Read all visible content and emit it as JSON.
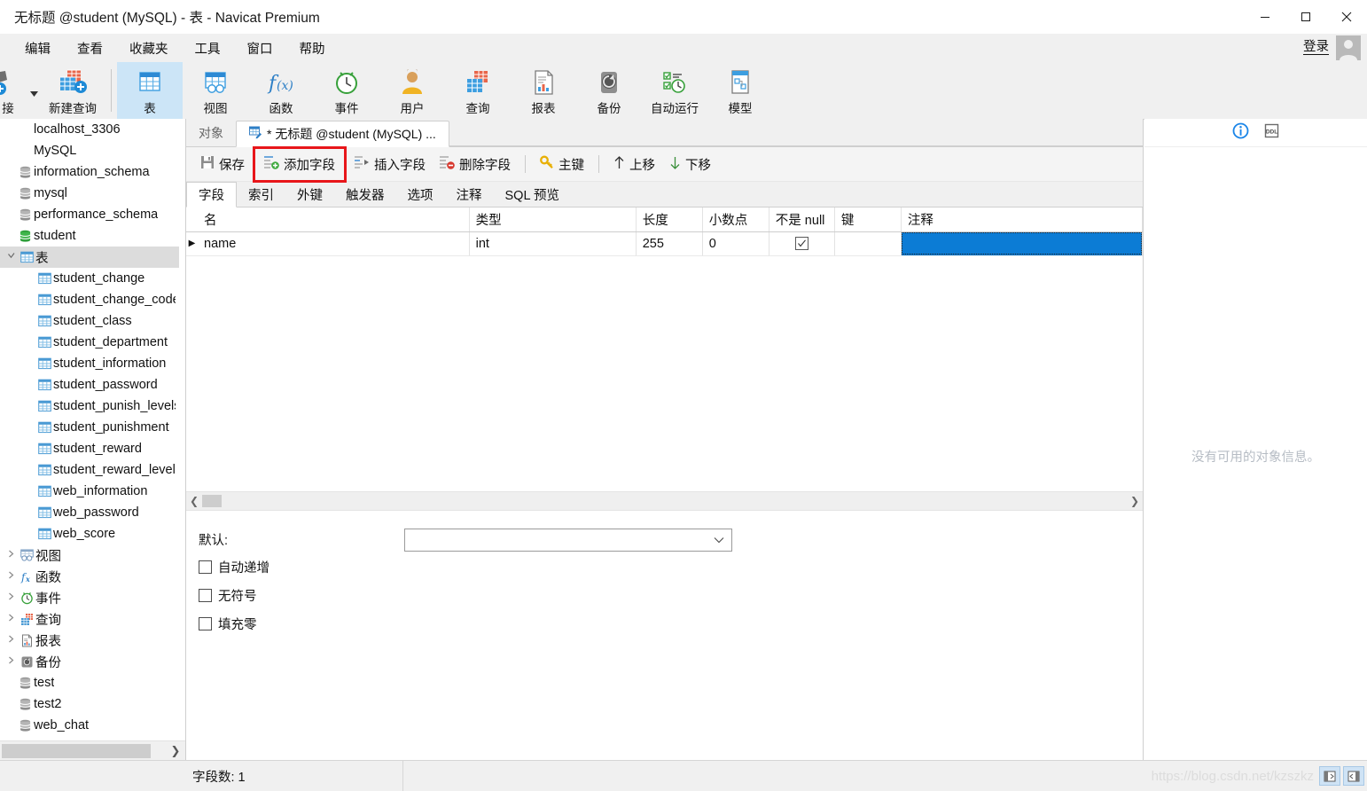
{
  "window": {
    "title": "无标题 @student (MySQL) - 表 - Navicat Premium",
    "minimize_label": "最小化",
    "maximize_label": "最大化",
    "close_label": "关闭"
  },
  "menubar": {
    "items": [
      {
        "label": "编辑",
        "name": "menu-edit"
      },
      {
        "label": "查看",
        "name": "menu-view"
      },
      {
        "label": "收藏夹",
        "name": "menu-favorites"
      },
      {
        "label": "工具",
        "name": "menu-tools"
      },
      {
        "label": "窗口",
        "name": "menu-window"
      },
      {
        "label": "帮助",
        "name": "menu-help"
      }
    ],
    "login_label": "登录"
  },
  "toolbar": {
    "items": [
      {
        "label": "接",
        "icon": "connection-icon",
        "active": false
      },
      {
        "label": "新建查询",
        "icon": "new-query-icon",
        "active": false
      },
      {
        "label": "表",
        "icon": "table-icon",
        "active": true
      },
      {
        "label": "视图",
        "icon": "view-icon",
        "active": false
      },
      {
        "label": "函数",
        "icon": "function-icon",
        "active": false
      },
      {
        "label": "事件",
        "icon": "event-icon",
        "active": false
      },
      {
        "label": "用户",
        "icon": "user-icon",
        "active": false
      },
      {
        "label": "查询",
        "icon": "query-icon",
        "active": false
      },
      {
        "label": "报表",
        "icon": "report-icon",
        "active": false
      },
      {
        "label": "备份",
        "icon": "backup-icon",
        "active": false
      },
      {
        "label": "自动运行",
        "icon": "automation-icon",
        "active": false
      },
      {
        "label": "模型",
        "icon": "model-icon",
        "active": false
      }
    ]
  },
  "sidebar": {
    "nodes": [
      {
        "label": "localhost_3306",
        "icon": "none",
        "indent": 0,
        "arrow": "",
        "selected": false
      },
      {
        "label": "MySQL",
        "icon": "none",
        "indent": 0,
        "arrow": "",
        "selected": false
      },
      {
        "label": "information_schema",
        "icon": "database-icon",
        "indent": 0,
        "arrow": "",
        "selected": false
      },
      {
        "label": "mysql",
        "icon": "database-icon",
        "indent": 0,
        "arrow": "",
        "selected": false
      },
      {
        "label": "performance_schema",
        "icon": "database-icon",
        "indent": 0,
        "arrow": "",
        "selected": false
      },
      {
        "label": "student",
        "icon": "database-open-icon",
        "indent": 0,
        "arrow": "",
        "selected": false
      },
      {
        "label": "表",
        "icon": "table-icon",
        "indent": 1,
        "arrow": "v",
        "selected": true
      },
      {
        "label": "student_change",
        "icon": "table-icon",
        "indent": 2,
        "arrow": "",
        "selected": false
      },
      {
        "label": "student_change_code",
        "icon": "table-icon",
        "indent": 2,
        "arrow": "",
        "selected": false
      },
      {
        "label": "student_class",
        "icon": "table-icon",
        "indent": 2,
        "arrow": "",
        "selected": false
      },
      {
        "label": "student_department",
        "icon": "table-icon",
        "indent": 2,
        "arrow": "",
        "selected": false
      },
      {
        "label": "student_information",
        "icon": "table-icon",
        "indent": 2,
        "arrow": "",
        "selected": false
      },
      {
        "label": "student_password",
        "icon": "table-icon",
        "indent": 2,
        "arrow": "",
        "selected": false
      },
      {
        "label": "student_punish_levels",
        "icon": "table-icon",
        "indent": 2,
        "arrow": "",
        "selected": false
      },
      {
        "label": "student_punishment",
        "icon": "table-icon",
        "indent": 2,
        "arrow": "",
        "selected": false
      },
      {
        "label": "student_reward",
        "icon": "table-icon",
        "indent": 2,
        "arrow": "",
        "selected": false
      },
      {
        "label": "student_reward_levels",
        "icon": "table-icon",
        "indent": 2,
        "arrow": "",
        "selected": false
      },
      {
        "label": "web_information",
        "icon": "table-icon",
        "indent": 2,
        "arrow": "",
        "selected": false
      },
      {
        "label": "web_password",
        "icon": "table-icon",
        "indent": 2,
        "arrow": "",
        "selected": false
      },
      {
        "label": "web_score",
        "icon": "table-icon",
        "indent": 2,
        "arrow": "",
        "selected": false
      },
      {
        "label": "视图",
        "icon": "view-icon",
        "indent": 1,
        "arrow": ">",
        "selected": false
      },
      {
        "label": "函数",
        "icon": "function-icon",
        "indent": 1,
        "arrow": ">",
        "selected": false
      },
      {
        "label": "事件",
        "icon": "event-icon",
        "indent": 1,
        "arrow": ">",
        "selected": false
      },
      {
        "label": "查询",
        "icon": "query-icon",
        "indent": 1,
        "arrow": ">",
        "selected": false
      },
      {
        "label": "报表",
        "icon": "report-icon",
        "indent": 1,
        "arrow": ">",
        "selected": false
      },
      {
        "label": "备份",
        "icon": "backup-icon",
        "indent": 1,
        "arrow": ">",
        "selected": false
      },
      {
        "label": "test",
        "icon": "database-icon",
        "indent": 0,
        "arrow": "",
        "selected": false
      },
      {
        "label": "test2",
        "icon": "database-icon",
        "indent": 0,
        "arrow": "",
        "selected": false
      },
      {
        "label": "web_chat",
        "icon": "database-icon",
        "indent": 0,
        "arrow": "",
        "selected": false
      }
    ]
  },
  "center": {
    "tabs": [
      {
        "label": "对象",
        "active": false,
        "icon": "none"
      },
      {
        "label": "* 无标题 @student (MySQL) ...",
        "active": true,
        "icon": "table-design-icon"
      }
    ],
    "actions": [
      {
        "label": "保存",
        "icon": "save-icon",
        "highlighted": false
      },
      {
        "label": "添加字段",
        "icon": "add-field-icon",
        "highlighted": true
      },
      {
        "label": "插入字段",
        "icon": "insert-field-icon",
        "highlighted": false
      },
      {
        "label": "删除字段",
        "icon": "delete-field-icon",
        "highlighted": false
      },
      {
        "label": "主键",
        "icon": "key-icon",
        "highlighted": false
      },
      {
        "label": "上移",
        "icon": "arrow-up-icon",
        "highlighted": false
      },
      {
        "label": "下移",
        "icon": "arrow-down-icon",
        "highlighted": false
      }
    ],
    "subtabs": [
      {
        "label": "字段",
        "active": true
      },
      {
        "label": "索引",
        "active": false
      },
      {
        "label": "外键",
        "active": false
      },
      {
        "label": "触发器",
        "active": false
      },
      {
        "label": "选项",
        "active": false
      },
      {
        "label": "注释",
        "active": false
      },
      {
        "label": "SQL 预览",
        "active": false
      }
    ],
    "grid": {
      "columns": [
        "名",
        "类型",
        "长度",
        "小数点",
        "不是 null",
        "键",
        "注释"
      ],
      "rows": [
        {
          "marker": "▶",
          "name": "name",
          "type": "int",
          "length": "255",
          "decimals": "0",
          "not_null": true,
          "key": "",
          "comment": "",
          "comment_selected": true
        }
      ]
    },
    "properties": {
      "default_label": "默认:",
      "default_value": "",
      "checkboxes": [
        {
          "label": "自动递增",
          "checked": false
        },
        {
          "label": "无符号",
          "checked": false
        },
        {
          "label": "填充零",
          "checked": false
        }
      ]
    }
  },
  "right_panel": {
    "buttons": [
      {
        "name": "info-icon",
        "label": "信息"
      },
      {
        "name": "ddl-icon",
        "label": "DDL"
      }
    ],
    "empty_text": "没有可用的对象信息。"
  },
  "statusbar": {
    "field_count": "字段数: 1",
    "watermark": "https://blog.csdn.net/kzszkz"
  },
  "colors": {
    "accent_blue": "#0c7cd5",
    "toolbar_active": "#cce5f7",
    "highlight_red": "#e8161a",
    "tree_selected": "#dcdcdc"
  }
}
